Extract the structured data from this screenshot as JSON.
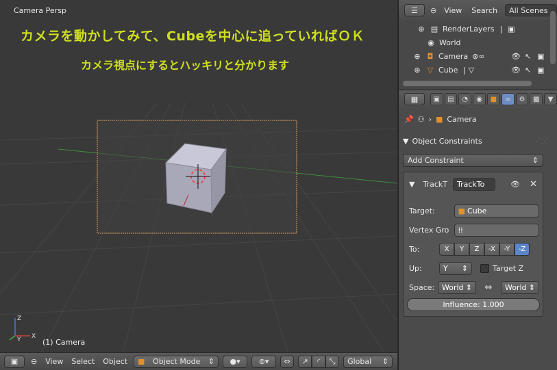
{
  "viewport": {
    "title": "Camera Persp",
    "overlay_line1": "カメラを動かしてみて、Cubeを中心に追っていればＯＫ",
    "overlay_line2": "カメラ視点にするとハッキリと分かります",
    "object_label": "(1) Camera",
    "axis_z": "Z",
    "axis_x": "X",
    "axis_y": "Y"
  },
  "header": {
    "menu_view": "View",
    "menu_select": "Select",
    "menu_object": "Object",
    "mode": "Object Mode",
    "orientation": "Global"
  },
  "outliner": {
    "view": "View",
    "search": "Search",
    "scenes": "All Scenes",
    "items": [
      {
        "label": "RenderLayers",
        "icon": "render-layers-icon"
      },
      {
        "label": "World",
        "icon": "world-icon"
      },
      {
        "label": "Camera",
        "icon": "camera-icon"
      },
      {
        "label": "Cube",
        "icon": "mesh-icon"
      }
    ]
  },
  "properties": {
    "breadcrumb_object": "Camera",
    "panel_title": "Object Constraints",
    "add_constraint": "Add Constraint",
    "constraint": {
      "type_short": "TrackT",
      "name": "TrackTo",
      "target_label": "Target:",
      "target_value": "Cube",
      "vertex_group_label": "Vertex Gro",
      "to_label": "To:",
      "to_axes": [
        "X",
        "Y",
        "Z",
        "-X",
        "-Y",
        "-Z"
      ],
      "to_active": "-Z",
      "up_label": "Up:",
      "up_value": "Y",
      "target_z_label": "Target Z",
      "space_label": "Space:",
      "space_owner": "World",
      "space_target": "World",
      "influence": "Influence: 1.000"
    }
  },
  "colors": {
    "overlay_text": "#cfe01f",
    "active_blue": "#5b86c9",
    "camera_frame": "#e0a060"
  }
}
